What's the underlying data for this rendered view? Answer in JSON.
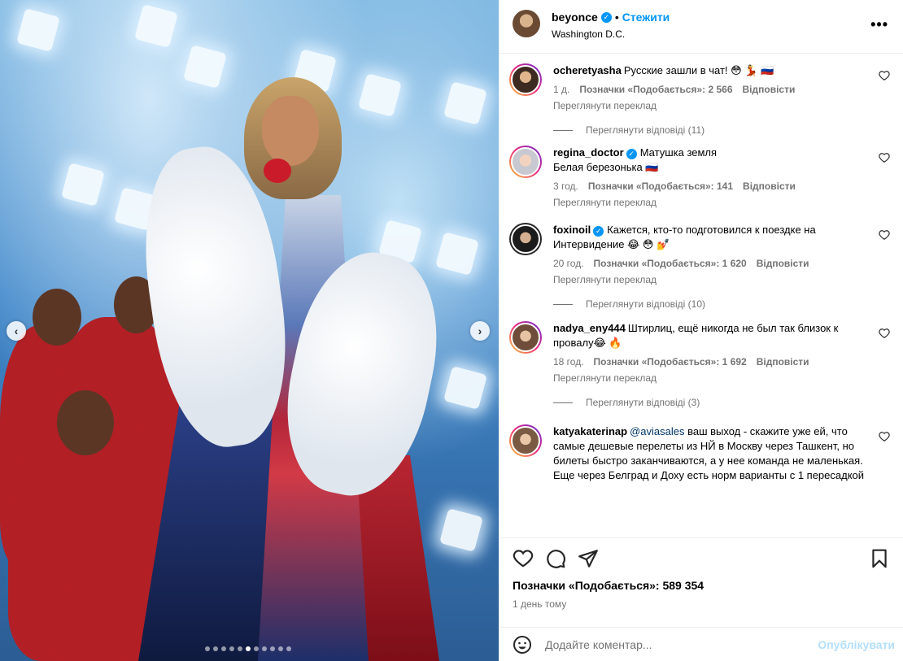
{
  "header": {
    "username": "beyonce",
    "separator": "•",
    "follow_label": "Стежити",
    "location": "Washington D.C."
  },
  "comments": [
    {
      "username": "ocheretyasha",
      "verified": false,
      "text": "Русские зашли в чат! 😳 💃 🇷🇺",
      "time": "1 д.",
      "likes": "Позначки «Подобається»: 2 566",
      "reply": "Відповісти",
      "translate": "Переглянути переклад",
      "view_replies": "Переглянути відповіді (11)"
    },
    {
      "username": "regina_doctor",
      "verified": true,
      "text": "Матушка земля",
      "text_line2": "Белая березонька 🇷🇺",
      "time": "3 год.",
      "likes": "Позначки «Подобається»: 141",
      "reply": "Відповісти",
      "translate": "Переглянути переклад"
    },
    {
      "username": "foxinoil",
      "verified": true,
      "text": "Кажется, кто-то подготовился к поездке на Интервидение 😂 😳 💅",
      "time": "20 год.",
      "likes": "Позначки «Подобається»: 1 620",
      "reply": "Відповісти",
      "translate": "Переглянути переклад",
      "view_replies": "Переглянути відповіді (10)"
    },
    {
      "username": "nadya_eny444",
      "verified": false,
      "text": "Штирлиц, ещё никогда не был так близок к провалу😂 🔥",
      "time": "18 год.",
      "likes": "Позначки «Подобається»: 1 692",
      "reply": "Відповісти",
      "translate": "Переглянути переклад",
      "view_replies": "Переглянути відповіді (3)"
    },
    {
      "username": "katyakaterinap",
      "verified": false,
      "mention": "@aviasales",
      "text": " ваш выход - скажите уже ей, что самые дешевые перелеты из НЙ в Москву через Ташкент, но билеты быстро заканчиваются, а у нее команда не маленькая. Еще через Белград и Доху есть норм варианты с 1 пересадкой"
    }
  ],
  "actions": {
    "likes_total": "Позначки «Подобається»: 589 354",
    "posted": "1 день тому"
  },
  "composer": {
    "placeholder": "Додайте коментар...",
    "publish_label": "Опублікувати"
  },
  "carousel": {
    "total_slides": 11,
    "active_slide": 5
  },
  "colors": {
    "accent": "#0095f6",
    "muted_text": "#737373",
    "publish_disabled": "#b2dffc"
  },
  "icons": [
    "more-options-icon",
    "heart-icon",
    "comment-icon",
    "share-icon",
    "bookmark-icon",
    "emoji-icon",
    "verified-icon",
    "chevron-left-icon",
    "chevron-right-icon"
  ]
}
